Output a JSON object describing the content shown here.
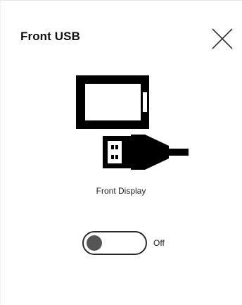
{
  "panel": {
    "title": "Front USB",
    "close_icon": "close-icon"
  },
  "illustration": {
    "icons": [
      "display-icon",
      "usb-plug-icon"
    ]
  },
  "device": {
    "label": "Front Display"
  },
  "toggle": {
    "state_label": "Off",
    "is_on": false
  },
  "colors": {
    "background": "#ffffff",
    "foreground": "#000000",
    "knob": "#555555"
  }
}
